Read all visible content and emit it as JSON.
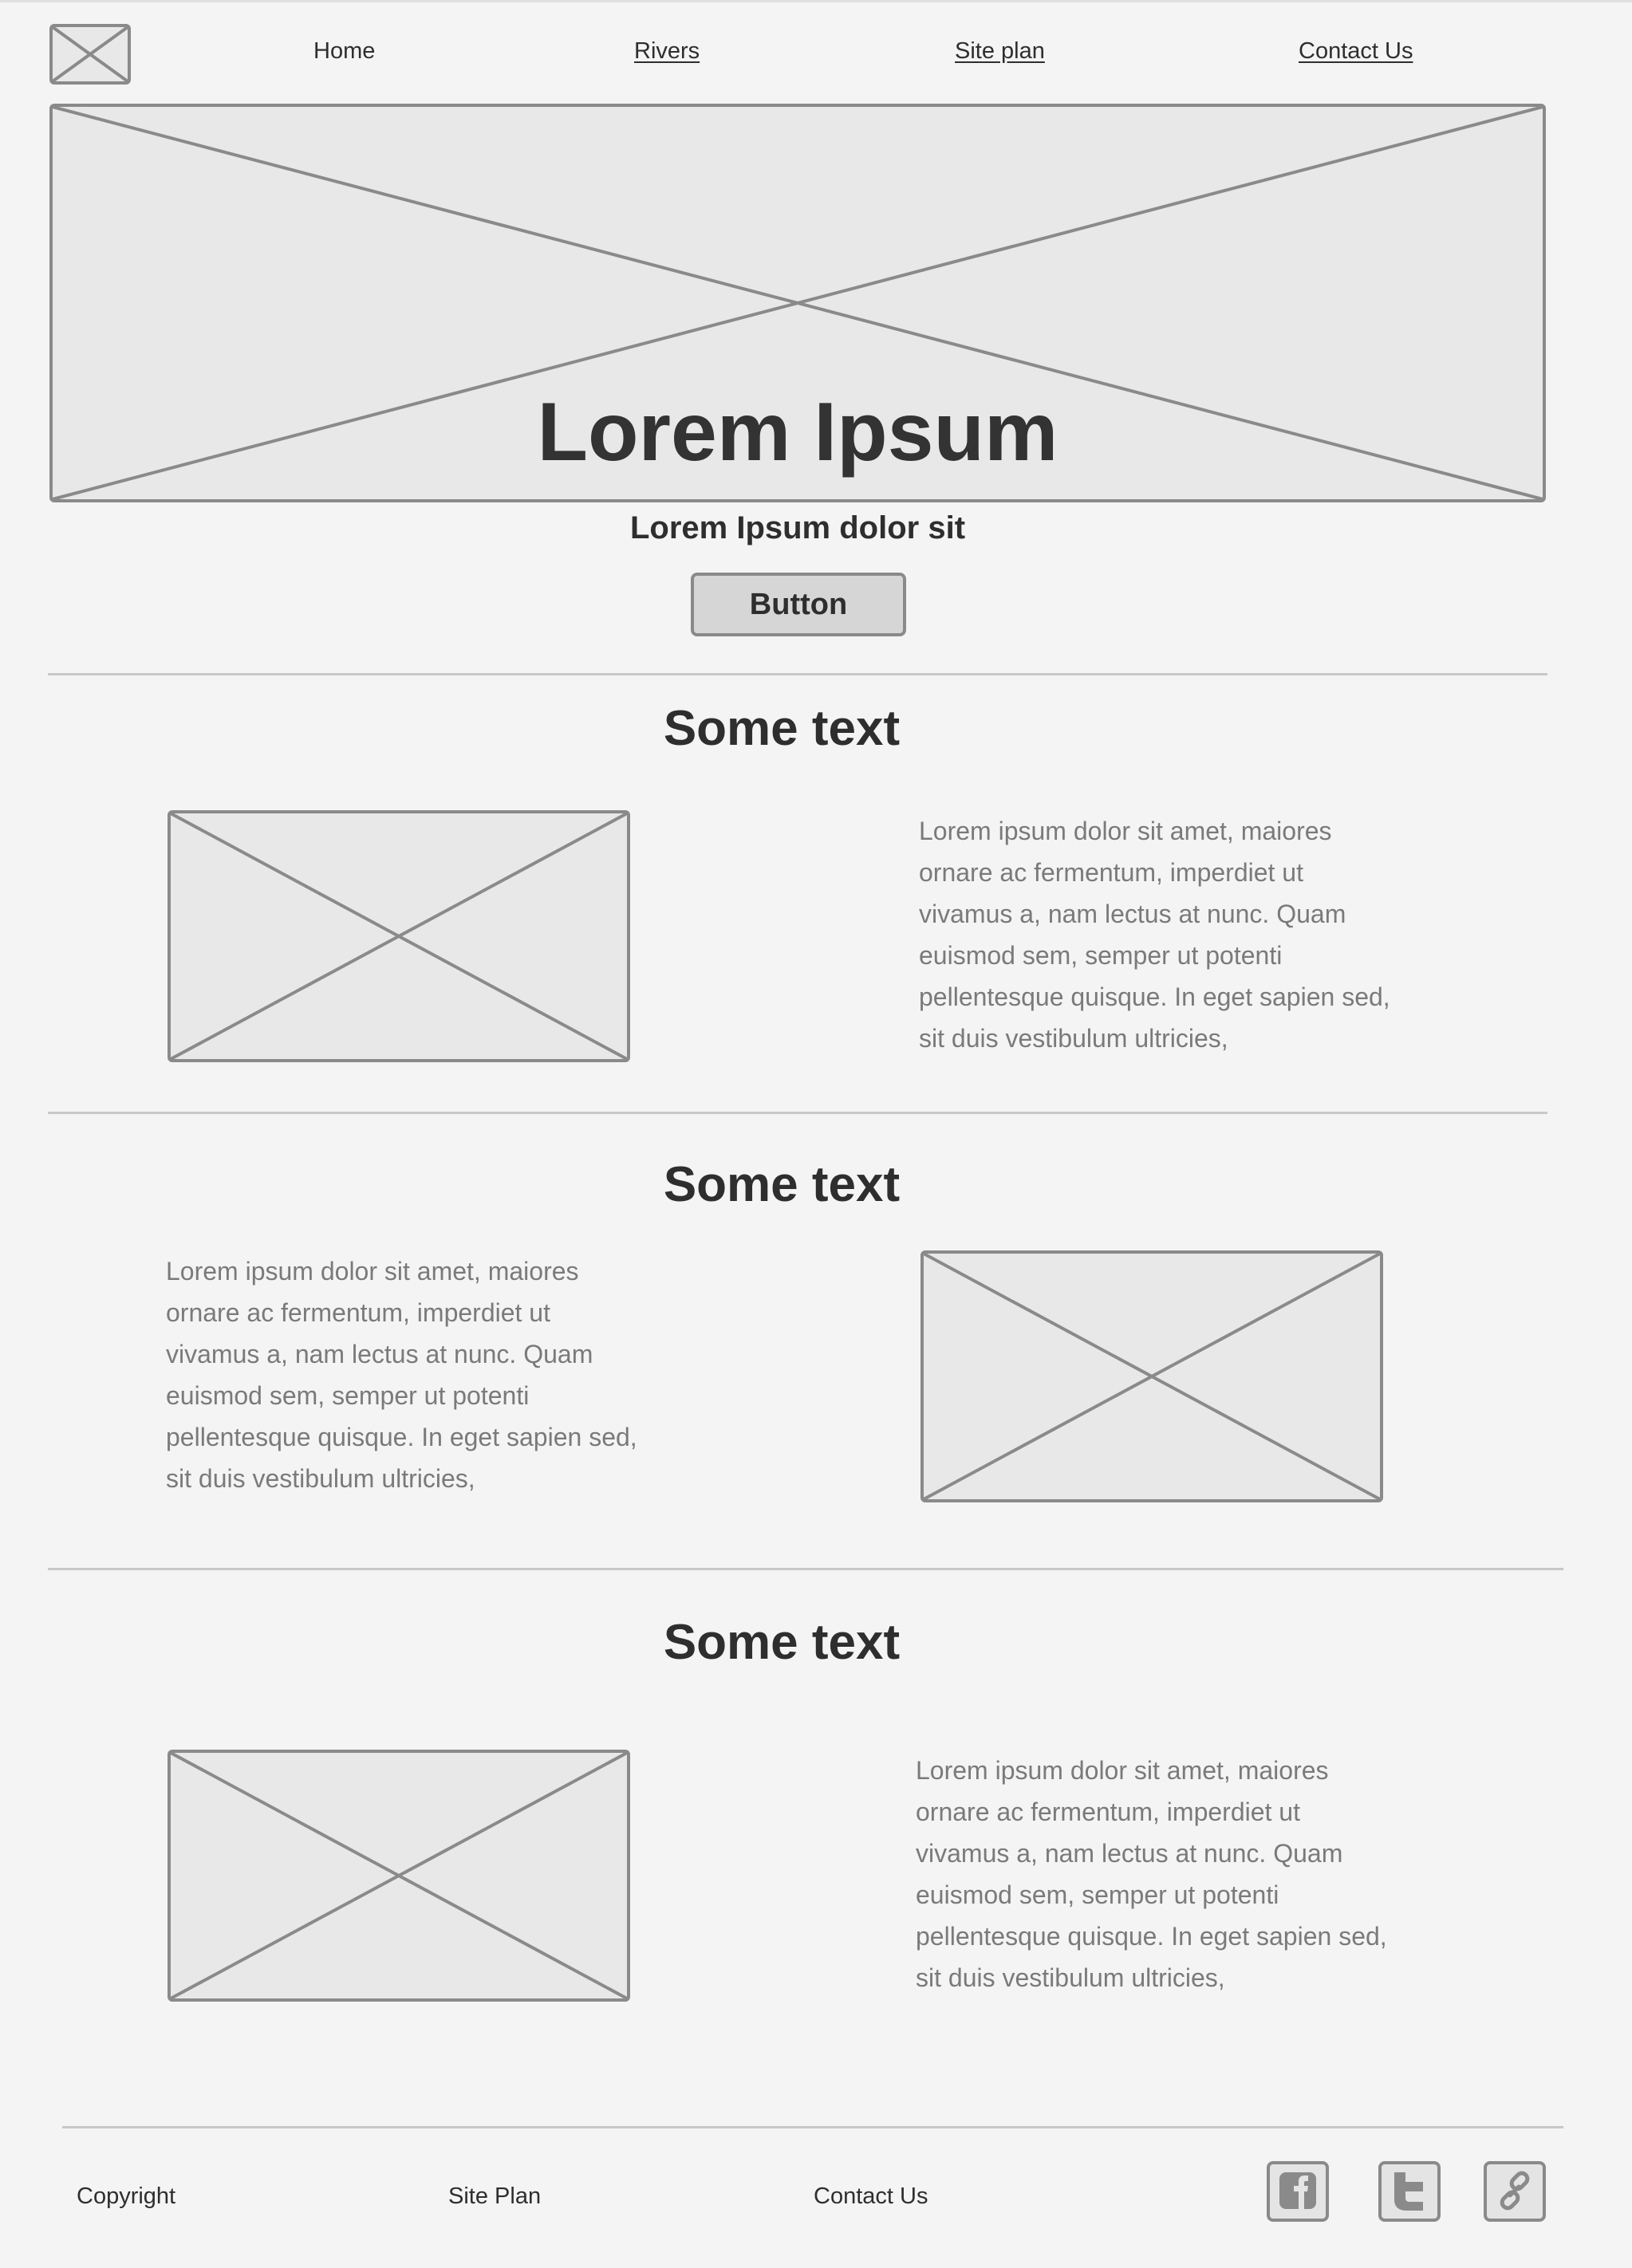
{
  "nav": {
    "items": [
      {
        "label": "Home"
      },
      {
        "label": "Rivers"
      },
      {
        "label": "Site plan"
      },
      {
        "label": "Contact Us"
      }
    ]
  },
  "hero": {
    "title": "Lorem Ipsum",
    "subtitle": "Lorem Ipsum dolor sit",
    "button_label": "Button"
  },
  "sections": [
    {
      "title": "Some text",
      "text": "Lorem ipsum dolor sit amet, maiores ornare ac fermentum, imperdiet ut vivamus a, nam lectus at nunc. Quam euismod sem, semper ut potenti pellentesque quisque. In eget sapien sed, sit duis vestibulum ultricies,"
    },
    {
      "title": "Some text",
      "text": "Lorem ipsum dolor sit amet, maiores ornare ac fermentum, imperdiet ut vivamus a, nam lectus at nunc. Quam euismod sem, semper ut potenti pellentesque quisque. In eget sapien sed, sit duis vestibulum ultricies,"
    },
    {
      "title": "Some text",
      "text": "Lorem ipsum dolor sit amet, maiores ornare ac fermentum, imperdiet ut vivamus a, nam lectus at nunc. Quam euismod sem, semper ut potenti pellentesque quisque. In eget sapien sed, sit duis vestibulum ultricies,"
    }
  ],
  "footer": {
    "copyright": "Copyright",
    "site_plan": "Site Plan",
    "contact": "Contact Us",
    "social": [
      {
        "icon": "facebook-icon"
      },
      {
        "icon": "twitter-icon"
      },
      {
        "icon": "link-icon"
      }
    ]
  },
  "colors": {
    "background": "#f4f4f4",
    "placeholder_fill": "#e8e8e8",
    "placeholder_stroke": "#8a8a8a",
    "heading_text": "#2e2e2e",
    "body_text": "#7a7a7a",
    "button_fill": "#d6d6d6",
    "divider": "#c8c8c8"
  }
}
